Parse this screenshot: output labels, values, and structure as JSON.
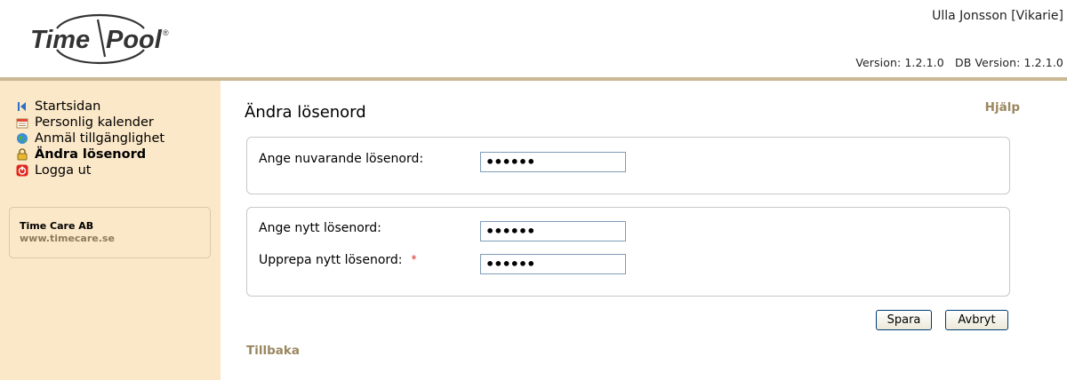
{
  "brand": {
    "logo_text_left": "Time",
    "logo_text_right": "Pool",
    "trademark": "®"
  },
  "header": {
    "user": "Ulla Jonsson [Vikarie]",
    "version": "Version: 1.2.1.0   DB Version: 1.2.1.0"
  },
  "sidebar": {
    "items": [
      {
        "label": "Startsidan",
        "icon": "home-arrow-icon"
      },
      {
        "label": "Personlig kalender",
        "icon": "calendar-icon"
      },
      {
        "label": "Anmäl tillgänglighet",
        "icon": "globe-icon"
      },
      {
        "label": "Ändra lösenord",
        "icon": "lock-icon",
        "active": true
      },
      {
        "label": "Logga ut",
        "icon": "power-icon"
      }
    ],
    "company": "Time Care AB",
    "url": "www.timecare.se"
  },
  "main": {
    "title": "Ändra lösenord",
    "help": "Hjälp",
    "current_label": "Ange nuvarande lösenord:",
    "current_value": "••••••",
    "new_label": "Ange nytt lösenord:",
    "new_value": "••••••",
    "repeat_label": "Upprepa nytt lösenord:",
    "required_mark": "*",
    "repeat_value": "••••••",
    "save": "Spara",
    "cancel": "Avbryt",
    "back": "Tillbaka"
  },
  "colors": {
    "accent": "#9a875f",
    "sidebar_bg": "#fbe8c8",
    "rule": "#c9b893",
    "required": "#e0261c"
  }
}
